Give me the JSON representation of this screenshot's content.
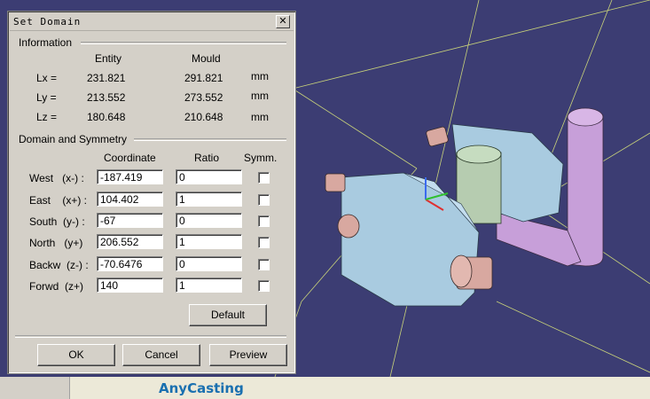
{
  "dialog": {
    "title": "Set Domain",
    "close_glyph": "✕",
    "information": {
      "label": "Information",
      "col_entity": "Entity",
      "col_mould": "Mould",
      "rows": [
        {
          "label": "Lx =",
          "entity": "231.821",
          "mould": "291.821",
          "unit": "mm"
        },
        {
          "label": "Ly =",
          "entity": "213.552",
          "mould": "273.552",
          "unit": "mm"
        },
        {
          "label": "Lz =",
          "entity": "180.648",
          "mould": "210.648",
          "unit": "mm"
        }
      ]
    },
    "domain": {
      "label": "Domain and Symmetry",
      "col_coordinate": "Coordinate",
      "col_ratio": "Ratio",
      "col_symm": "Symm.",
      "rows": [
        {
          "label": "West   (x-) :",
          "coordinate": "-187.419",
          "ratio": "0",
          "symm": false
        },
        {
          "label": "East    (x+) :",
          "coordinate": "104.402",
          "ratio": "1",
          "symm": false
        },
        {
          "label": "South  (y-) :",
          "coordinate": "-67",
          "ratio": "0",
          "symm": false
        },
        {
          "label": "North   (y+)",
          "coordinate": "206.552",
          "ratio": "1",
          "symm": false
        },
        {
          "label": "Backw  (z-) :",
          "coordinate": "-70.6476",
          "ratio": "0",
          "symm": false
        },
        {
          "label": "Forwd  (z+)",
          "coordinate": "140",
          "ratio": "1",
          "symm": false
        }
      ]
    },
    "buttons": {
      "default": "Default",
      "ok": "OK",
      "cancel": "Cancel",
      "preview": "Preview"
    }
  },
  "background": {
    "brand": "AnyCasting"
  },
  "colors": {
    "viewport_bg": "#3c3d73",
    "part_blue": "#a9cbe0",
    "core_green": "#b6ccb0",
    "pin_pink": "#d8a8a0",
    "rod_purple": "#c79fd9"
  }
}
